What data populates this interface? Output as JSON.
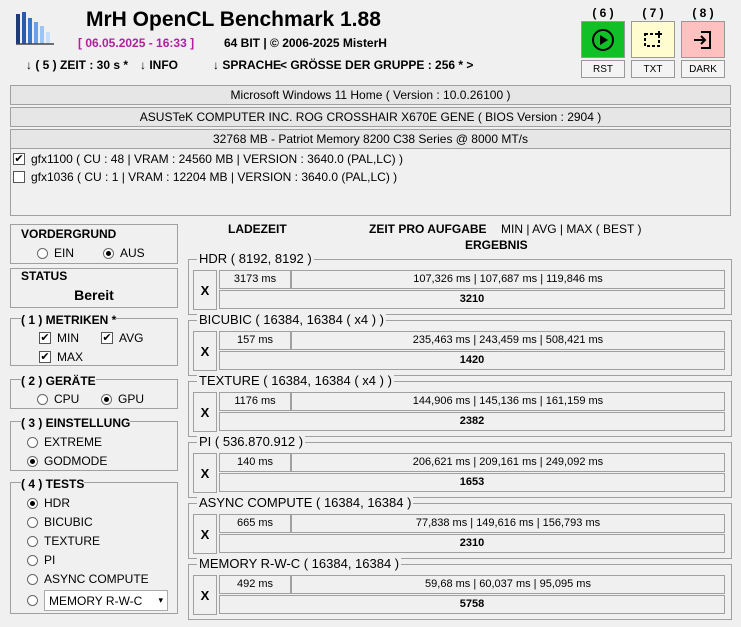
{
  "app": {
    "title": "MrH OpenCL Benchmark 1.88",
    "date": "[ 06.05.2025 - 16:33 ]",
    "bits": "64 BIT | ©  2006-2025 MisterH"
  },
  "toolbar": [
    {
      "num": "( 6 )",
      "label": "RST",
      "icon": "play-icon",
      "color": "#11c026"
    },
    {
      "num": "( 7 )",
      "label": "TXT",
      "icon": "crop-select-icon",
      "color": "#fffdd0"
    },
    {
      "num": "( 8 )",
      "label": "DARK",
      "icon": "sign-in-icon",
      "color": "#ffc0c0"
    }
  ],
  "menu": {
    "zeit": "↓ ( 5 ) ZEIT : 30 s *",
    "info": "↓ INFO",
    "sprache": "↓ SPRACHE",
    "gruppe": "< GRÖSSE DER GRUPPE : 256 * >"
  },
  "system": {
    "os": "Microsoft Windows 11 Home ( Version : 10.0.26100 )",
    "board": "ASUSTeK COMPUTER INC. ROG CROSSHAIR X670E GENE ( BIOS Version : 2904 )",
    "memory": "32768 MB - Patriot Memory 8200 C38 Series @ 8000 MT/s"
  },
  "devices": [
    {
      "label": "gfx1100 ( CU : 48 | VRAM : 24560 MB | VERSION : 3640.0 (PAL,LC) )",
      "checked": true
    },
    {
      "label": "gfx1036 ( CU : 1 | VRAM : 12204 MB | VERSION : 3640.0 (PAL,LC) )",
      "checked": false
    }
  ],
  "vordergrund": {
    "title": "VORDERGRUND",
    "ein": "EIN",
    "aus": "AUS",
    "selected": "aus"
  },
  "status": {
    "title": "STATUS",
    "value": "Bereit"
  },
  "metriken": {
    "title": "( 1 ) METRIKEN *",
    "min": "MIN",
    "avg": "AVG",
    "max": "MAX"
  },
  "geraete": {
    "title": "( 2 ) GERÄTE",
    "cpu": "CPU",
    "gpu": "GPU",
    "selected": "gpu"
  },
  "einstellung": {
    "title": "( 3 ) EINSTELLUNG",
    "extreme": "EXTREME",
    "godmode": "GODMODE",
    "selected": "godmode"
  },
  "tests_panel": {
    "title": "( 4 ) TESTS",
    "items": [
      "HDR",
      "BICUBIC",
      "TEXTURE",
      "PI",
      "ASYNC COMPUTE",
      "MEMORY R-W-C"
    ],
    "selected": "HDR"
  },
  "columns": {
    "ladezeit": "LADEZEIT",
    "zeit": "ZEIT PRO AUFGABE",
    "metrics": "MIN | AVG | MAX ( BEST )",
    "ergebnis": "ERGEBNIS"
  },
  "results": [
    {
      "name": "HDR ( 8192, 8192 )",
      "x": "X",
      "load": "3173 ms",
      "times": "107,326 ms | 107,687 ms | 119,846 ms",
      "score": "3210"
    },
    {
      "name": "BICUBIC ( 16384, 16384 ( x4 ) )",
      "x": "X",
      "load": "157 ms",
      "times": "235,463 ms | 243,459 ms | 508,421 ms",
      "score": "1420"
    },
    {
      "name": "TEXTURE ( 16384, 16384 ( x4 ) )",
      "x": "X",
      "load": "1176 ms",
      "times": "144,906 ms | 145,136 ms | 161,159 ms",
      "score": "2382"
    },
    {
      "name": "PI ( 536.870.912 )",
      "x": "X",
      "load": "140 ms",
      "times": "206,621 ms | 209,161 ms | 249,092 ms",
      "score": "1653"
    },
    {
      "name": "ASYNC COMPUTE ( 16384, 16384 )",
      "x": "X",
      "load": "665 ms",
      "times": "77,838 ms | 149,616 ms | 156,793 ms",
      "score": "2310"
    },
    {
      "name": "MEMORY R-W-C ( 16384, 16384 )",
      "x": "X",
      "load": "492 ms",
      "times": "59,68 ms | 60,037 ms | 95,095 ms",
      "score": "5758"
    }
  ]
}
